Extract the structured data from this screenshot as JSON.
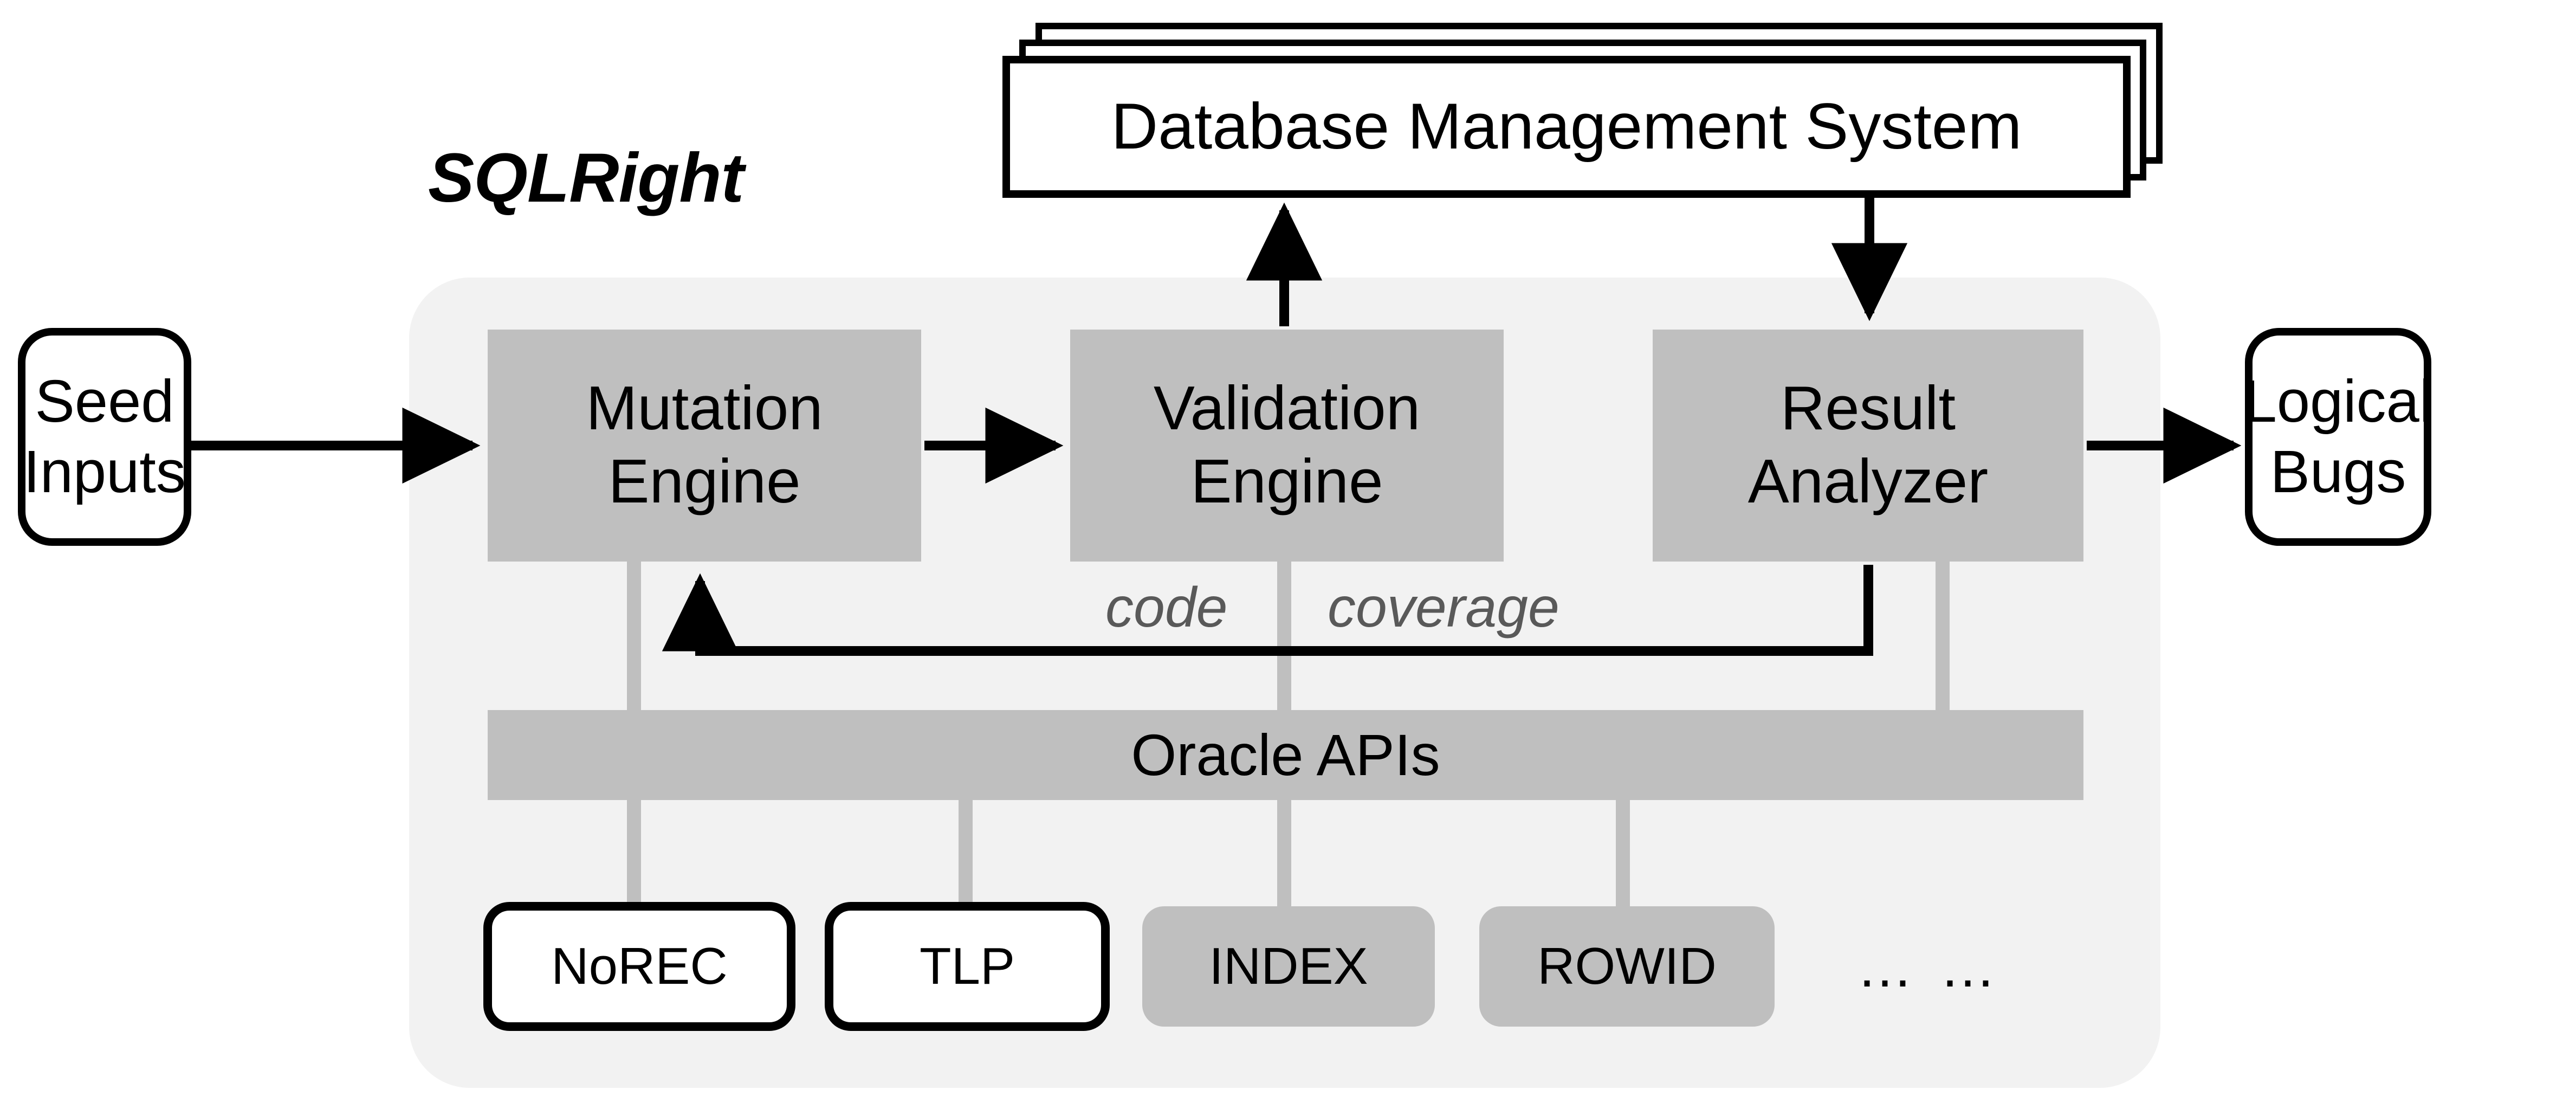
{
  "figure": {
    "title": "SQLRight",
    "background_color": "#ffffff"
  },
  "palette": {
    "panel_fill": "#f2f2f2",
    "block_fill": "#bfbfbf",
    "connector_gray": "#bfbfbf",
    "stroke_black": "#000000",
    "italic_gray_text": "#595959",
    "white_fill": "#ffffff"
  },
  "external_nodes": {
    "seed_inputs": {
      "lines": [
        "Seed",
        "Inputs"
      ],
      "shape": "rounded-rect-outline",
      "fill": "#ffffff"
    },
    "logical_bugs": {
      "lines": [
        "Logical",
        "Bugs"
      ],
      "shape": "rounded-rect-outline",
      "fill": "#ffffff"
    },
    "dbms": {
      "label": "Database  Management System",
      "shape": "stacked-rect-outline",
      "stack_count": 3,
      "fill": "#ffffff"
    }
  },
  "pipeline": {
    "blocks": [
      {
        "id": "mutation-engine",
        "lines": [
          "Mutation",
          "Engine"
        ],
        "fill": "#bfbfbf"
      },
      {
        "id": "validation-engine",
        "lines": [
          "Validation",
          "Engine"
        ],
        "fill": "#bfbfbf"
      },
      {
        "id": "result-analyzer",
        "lines": [
          "Result",
          "Analyzer"
        ],
        "fill": "#bfbfbf"
      }
    ],
    "oracle_bar": {
      "label": "Oracle APIs",
      "fill": "#bfbfbf"
    },
    "feedback_label": {
      "part1": "code",
      "part2": "coverage",
      "full": "code coverage",
      "color": "#595959"
    }
  },
  "oracles": [
    {
      "id": "norec",
      "label": "NoREC",
      "style": "outline",
      "fill": "#ffffff"
    },
    {
      "id": "tlp",
      "label": "TLP",
      "style": "outline",
      "fill": "#ffffff"
    },
    {
      "id": "index",
      "label": "INDEX",
      "style": "filled",
      "fill": "#bfbfbf"
    },
    {
      "id": "rowid",
      "label": "ROWID",
      "style": "filled",
      "fill": "#bfbfbf"
    }
  ],
  "ellipsis": "… …",
  "edges": [
    {
      "from": "seed-inputs",
      "to": "mutation-engine",
      "kind": "arrow",
      "color": "#000000"
    },
    {
      "from": "mutation-engine",
      "to": "validation-engine",
      "kind": "arrow",
      "color": "#000000"
    },
    {
      "from": "validation-engine",
      "to": "dbms",
      "kind": "arrow",
      "color": "#000000"
    },
    {
      "from": "dbms",
      "to": "result-analyzer",
      "kind": "arrow",
      "color": "#000000"
    },
    {
      "from": "result-analyzer",
      "to": "logical-bugs",
      "kind": "arrow",
      "color": "#000000"
    },
    {
      "from": "result-analyzer",
      "to": "mutation-engine",
      "kind": "feedback-arrow",
      "label": "code coverage",
      "color": "#000000"
    },
    {
      "from": "mutation-engine",
      "to": "oracle-apis",
      "kind": "line",
      "color": "#bfbfbf"
    },
    {
      "from": "validation-engine",
      "to": "oracle-apis",
      "kind": "line",
      "color": "#bfbfbf"
    },
    {
      "from": "result-analyzer",
      "to": "oracle-apis",
      "kind": "line",
      "color": "#bfbfbf"
    },
    {
      "from": "oracle-apis",
      "to": "norec",
      "kind": "line",
      "color": "#bfbfbf"
    },
    {
      "from": "oracle-apis",
      "to": "tlp",
      "kind": "line",
      "color": "#bfbfbf"
    },
    {
      "from": "oracle-apis",
      "to": "index",
      "kind": "line",
      "color": "#bfbfbf"
    },
    {
      "from": "oracle-apis",
      "to": "rowid",
      "kind": "line",
      "color": "#bfbfbf"
    }
  ]
}
